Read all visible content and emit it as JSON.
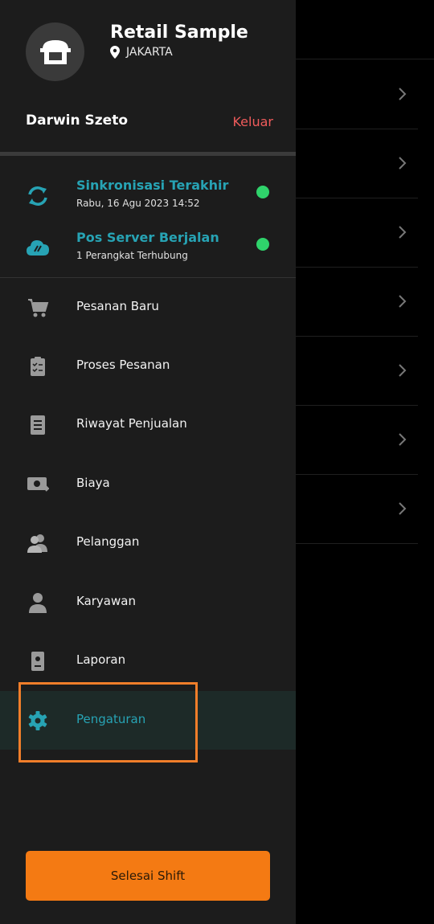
{
  "store": {
    "name": "Retail Sample",
    "location": "JAKARTA"
  },
  "user": {
    "name": "Darwin Szeto",
    "logout_label": "Keluar"
  },
  "status": [
    {
      "title": "Sinkronisasi Terakhir",
      "subtitle": "Rabu, 16 Agu 2023 14:52",
      "icon": "sync-icon",
      "state_color": "#2fd36b"
    },
    {
      "title": "Pos Server Berjalan",
      "subtitle": "1 Perangkat Terhubung",
      "icon": "cloud-server-icon",
      "state_color": "#2fd36b"
    }
  ],
  "menu": [
    {
      "label": "Pesanan Baru",
      "icon": "cart-icon"
    },
    {
      "label": "Proses Pesanan",
      "icon": "clipboard-icon"
    },
    {
      "label": "Riwayat Penjualan",
      "icon": "document-icon"
    },
    {
      "label": "Biaya",
      "icon": "money-icon"
    },
    {
      "label": "Pelanggan",
      "icon": "users-icon"
    },
    {
      "label": "Karyawan",
      "icon": "person-icon"
    },
    {
      "label": "Laporan",
      "icon": "report-icon"
    },
    {
      "label": "Pengaturan",
      "icon": "gear-icon",
      "active": true
    }
  ],
  "footer": {
    "shift_button_label": "Selesai Shift"
  },
  "colors": {
    "accent": "#27a3b4",
    "logout": "#ef5b5b",
    "status_ok": "#2fd36b",
    "button": "#f47a13",
    "highlight": "#f07e2a"
  }
}
